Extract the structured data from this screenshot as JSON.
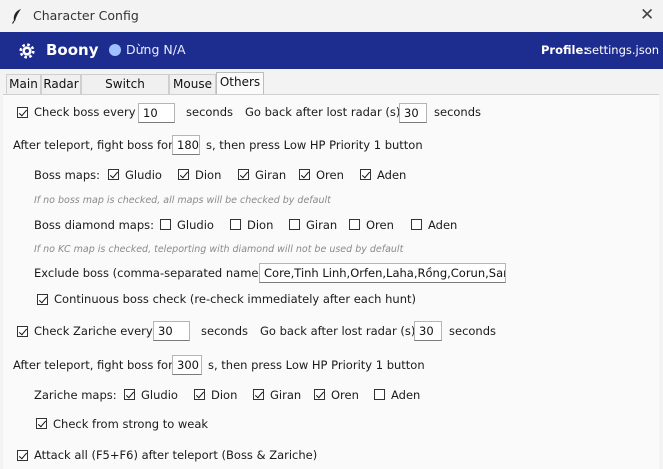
{
  "window": {
    "title": "Character Config",
    "close_glyph": "✕"
  },
  "header": {
    "brand": "Boony",
    "status": "Dừng  N/A",
    "profile_label": "Profile:",
    "profile_value": "settings.json",
    "accent": "#1d2c8f"
  },
  "tabs": [
    "Main",
    "Radar",
    "Switch weapon",
    "Mouse",
    "Others"
  ],
  "active_tab": "Others",
  "boss": {
    "check_label": "Check boss every",
    "check_checked": true,
    "interval": "10",
    "seconds": "seconds",
    "go_back_label": "Go back after lost radar (s):",
    "go_back_value": "30",
    "go_back_seconds": "seconds",
    "fight_prefix": "After teleport, fight boss for",
    "fight_value": "180",
    "fight_suffix": "s, then press Low HP Priority 1 button",
    "maps_label": "Boss maps:",
    "maps": [
      {
        "name": "Gludio",
        "checked": true
      },
      {
        "name": "Dion",
        "checked": true
      },
      {
        "name": "Giran",
        "checked": true
      },
      {
        "name": "Oren",
        "checked": true
      },
      {
        "name": "Aden",
        "checked": true
      }
    ],
    "maps_hint": "If no boss map is checked, all maps will be checked by default",
    "diamond_label": "Boss diamond maps:",
    "diamond_maps": [
      {
        "name": "Gludio",
        "checked": false
      },
      {
        "name": "Dion",
        "checked": false
      },
      {
        "name": "Giran",
        "checked": false
      },
      {
        "name": "Oren",
        "checked": false
      },
      {
        "name": "Aden",
        "checked": false
      }
    ],
    "diamond_hint": "If no KC map is checked, teleporting with diamond will not be used by default",
    "exclude_label": "Exclude boss (comma-separated names):",
    "exclude_value": "Core,Tinh Linh,Orfen,Laha,Rồng,Corun,Samuel",
    "continuous_label": "Continuous boss check (re-check immediately after each hunt)",
    "continuous_checked": true
  },
  "zariche": {
    "check_label": "Check Zariche every",
    "check_checked": true,
    "interval": "30",
    "seconds": "seconds",
    "go_back_label": "Go back after lost radar (s):",
    "go_back_value": "30",
    "go_back_seconds": "seconds",
    "fight_prefix": "After teleport, fight boss for",
    "fight_value": "300",
    "fight_suffix": "s, then press Low HP Priority 1 button",
    "maps_label": "Zariche maps:",
    "maps": [
      {
        "name": "Gludio",
        "checked": true
      },
      {
        "name": "Dion",
        "checked": true
      },
      {
        "name": "Giran",
        "checked": true
      },
      {
        "name": "Oren",
        "checked": true
      },
      {
        "name": "Aden",
        "checked": false
      }
    ],
    "strong_label": "Check from strong to weak",
    "strong_checked": true
  },
  "attack_all": {
    "label": "Attack all (F5+F6) after teleport (Boss & Zariche)",
    "checked": true
  }
}
